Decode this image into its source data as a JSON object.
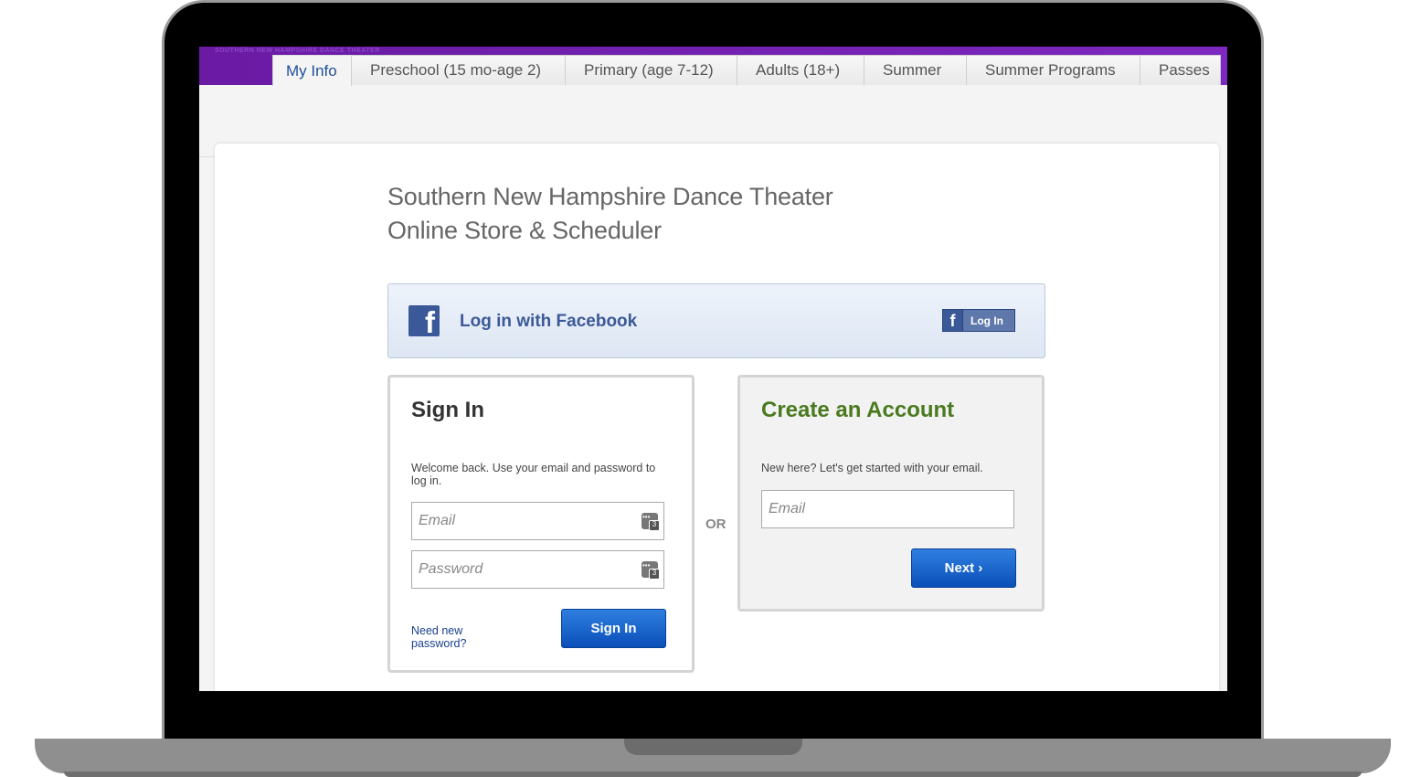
{
  "site": {
    "tiny_brand": "SOUTHERN NEW HAMPSHIRE DANCE THEATER"
  },
  "tabs": [
    {
      "label": "My Info",
      "active": true
    },
    {
      "label": "Preschool (15 mo-age 2)",
      "active": false
    },
    {
      "label": "Primary (age 7-12)",
      "active": false
    },
    {
      "label": "Adults (18+)",
      "active": false
    },
    {
      "label": "Summer",
      "active": false
    },
    {
      "label": "Summer Programs",
      "active": false
    },
    {
      "label": "Passes",
      "active": false
    }
  ],
  "page": {
    "title_line1": "Southern New Hampshire Dance Theater",
    "title_line2": "Online Store & Scheduler"
  },
  "facebook": {
    "text": "Log in with Facebook",
    "button_label": "Log In",
    "icon": "facebook-icon"
  },
  "signin": {
    "title": "Sign In",
    "description": "Welcome back. Use your email and password to log in.",
    "email_placeholder": "Email",
    "password_placeholder": "Password",
    "forgot_link": "Need new password?",
    "button_label": "Sign In"
  },
  "separator": "OR",
  "create": {
    "title": "Create an Account",
    "description": "New here? Let's get started with your email.",
    "email_placeholder": "Email",
    "button_label": "Next ›"
  },
  "colors": {
    "header_purple": "#6a1aa3",
    "facebook_blue": "#3b5998",
    "button_blue": "#0a4fb8",
    "create_green": "#4a7a1f",
    "tab_active_text": "#1f4f9a"
  }
}
